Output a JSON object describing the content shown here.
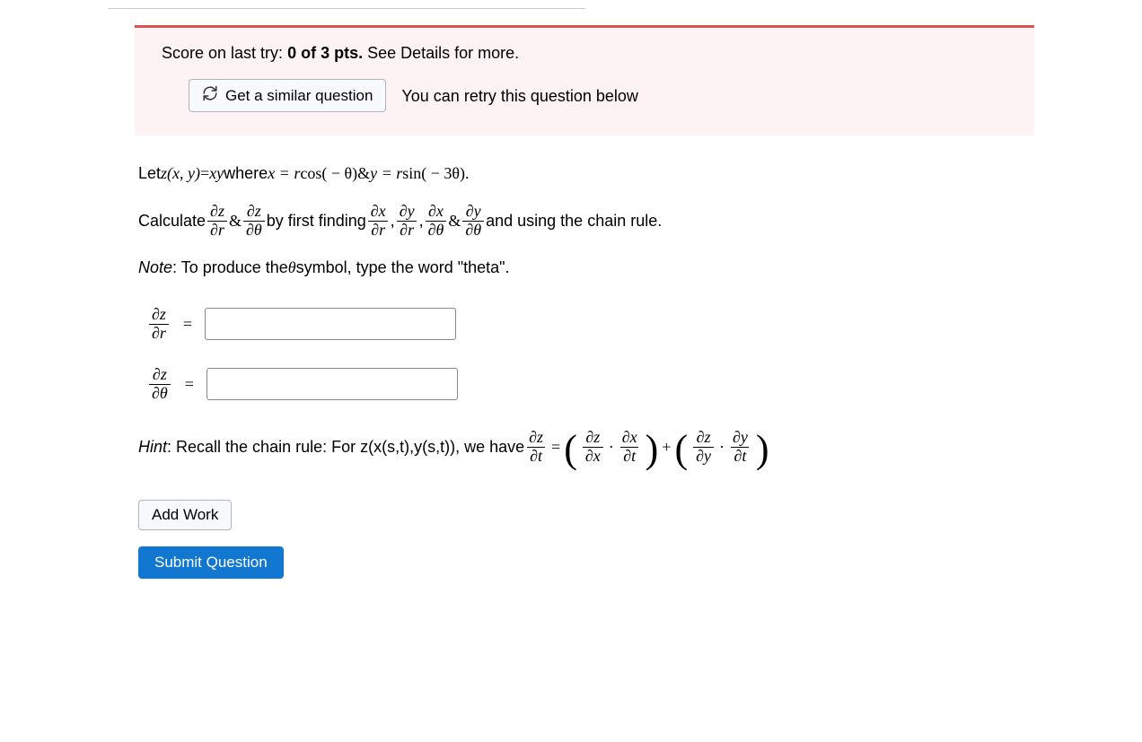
{
  "scorebox": {
    "score_prefix": "Score on last try: ",
    "score_value": "0 of 3 pts.",
    "score_suffix": " See Details for more.",
    "similar_btn": "Get a similar question",
    "retry_text": "You can retry this question below"
  },
  "q": {
    "let": "Let ",
    "where": " where ",
    "calc1": "Calculate ",
    "amp": " & ",
    "by_first": " by first finding ",
    "comma": ", ",
    "and_using": " and using the chain rule.",
    "note_label": "Note",
    "note_text": ": To produce the ",
    "note_text2": " symbol, type the word \"theta\".",
    "hint_label": "Hint",
    "hint_text": ": Recall the chain rule: For z(x(s,t),y(s,t)), we have ",
    "equals": " = ",
    "plus": " + ",
    "dot": " · "
  },
  "sym": {
    "z": "z",
    "x": "x",
    "y": "y",
    "r": "r",
    "t": "t",
    "theta": "θ",
    "partial": "∂",
    "cos": "cos",
    "sin": "sin",
    "eq1_lhs": "z(x, y)",
    "eq1_rhs1": "xy",
    "eq1_rhs2_a": "x = r ",
    "eq1_rhs2_b": "( − θ)",
    "eq1_rhs3_a": "y = r ",
    "eq1_rhs3_b": "( − 3θ).",
    "dz": "∂z",
    "dr": "∂r",
    "dtheta": "∂θ",
    "dx": "∂x",
    "dy": "∂y",
    "dt": "∂t"
  },
  "buttons": {
    "add_work": "Add Work",
    "submit": "Submit Question"
  }
}
